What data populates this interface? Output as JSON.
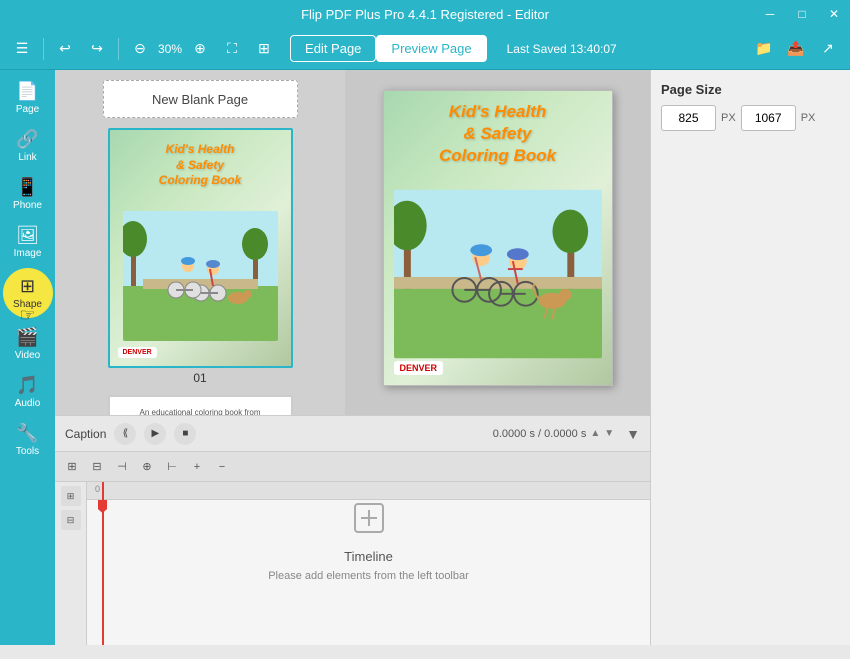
{
  "titlebar": {
    "title": "Flip PDF Plus Pro 4.4.1 Registered - Editor",
    "minimize_label": "─",
    "maximize_label": "□",
    "close_label": "✕"
  },
  "toolbar": {
    "zoom_value": "30%",
    "edit_page_label": "Edit Page",
    "preview_page_label": "Preview Page",
    "last_saved_label": "Last Saved 13:40:07"
  },
  "sidebar": {
    "items": [
      {
        "id": "page",
        "label": "Page",
        "icon": "📄"
      },
      {
        "id": "link",
        "label": "Link",
        "icon": "🔗"
      },
      {
        "id": "phone",
        "label": "Phone",
        "icon": "📱"
      },
      {
        "id": "image",
        "label": "Image",
        "icon": "🖼"
      },
      {
        "id": "shape",
        "label": "Shape",
        "icon": "⊞"
      },
      {
        "id": "video",
        "label": "Video",
        "icon": "🎬"
      },
      {
        "id": "audio",
        "label": "Audio",
        "icon": "🎵"
      },
      {
        "id": "tools",
        "label": "Tools",
        "icon": "🔧"
      }
    ]
  },
  "page_panel": {
    "new_blank_label": "New Blank Page",
    "page1_num": "01",
    "page1_title": "Kid's Health\n& Safety\nColoring Book",
    "page1_denver": "DENVER",
    "page2_text": "An educational coloring book from\nDenver's Department of Environmental Health"
  },
  "canvas": {
    "title": "Kid's Health\n& Safety\nColoring Book",
    "denver": "DENVER"
  },
  "right_panel": {
    "page_size_label": "Page Size",
    "width_value": "825",
    "height_value": "1067",
    "unit_label": "PX",
    "unit_label2": "PX"
  },
  "caption_bar": {
    "caption_label": "Caption",
    "time_display": "0.0000 s / 0.0000 s"
  },
  "timeline": {
    "icon": "⊕",
    "title": "Timeline",
    "subtitle": "Please add elements from the left toolbar",
    "ruler_zero": "0"
  }
}
